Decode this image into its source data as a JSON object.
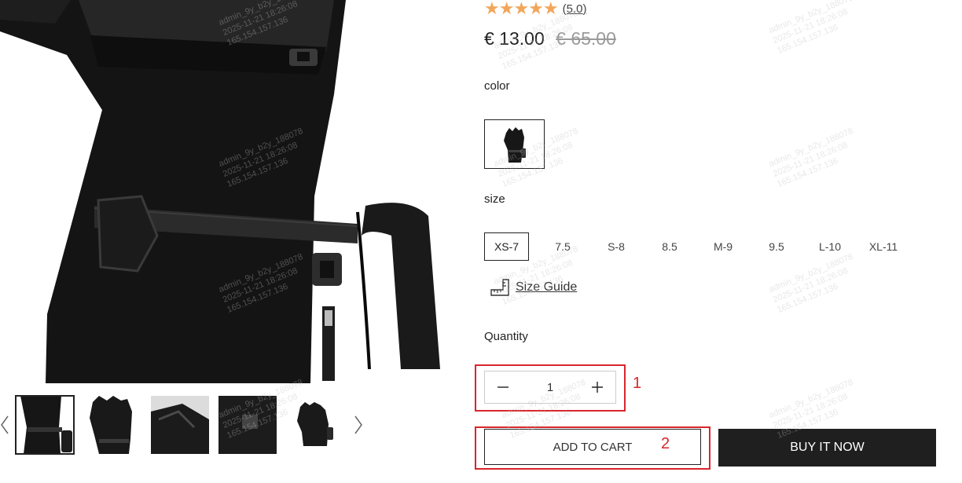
{
  "product": {
    "rating": {
      "stars": "★★★★★",
      "value": "(5.0)"
    },
    "price": {
      "sale": "€ 13.00",
      "compare": "€ 65.00"
    },
    "color": {
      "label": "color"
    },
    "size": {
      "label": "size",
      "options": [
        "XS-7",
        "7.5",
        "S-8",
        "8.5",
        "M-9",
        "9.5",
        "L-10",
        "XL-11"
      ],
      "selected": "XS-7"
    },
    "size_guide": "Size Guide",
    "quantity": {
      "label": "Quantity",
      "value": "1"
    },
    "buttons": {
      "add_to_cart": "ADD TO CART",
      "buy_now": "BUY IT NOW"
    }
  },
  "annotations": [
    {
      "label": "1"
    },
    {
      "label": "2"
    }
  ],
  "watermark": "admin_9y_b2y_188078\n2025-11-21 18:26:08\n165.154.157.136",
  "colors": {
    "accent_star": "#f2a65a",
    "annotation": "#d7262b",
    "dark_button": "#1f1f1f"
  }
}
